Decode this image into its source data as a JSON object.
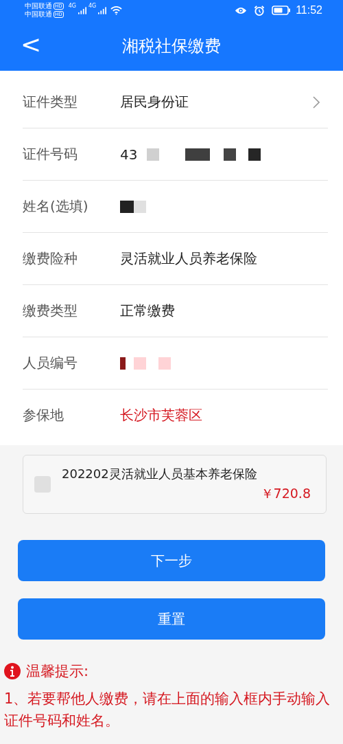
{
  "status_bar": {
    "carriers": [
      {
        "name": "中国联通",
        "badge": "HD"
      },
      {
        "name": "中国联通",
        "badge": "HD"
      }
    ],
    "signals": [
      {
        "network": "4G"
      },
      {
        "network": "4G"
      }
    ],
    "time": "11:52"
  },
  "header": {
    "title": "湘税社保缴费",
    "back": "<"
  },
  "form": [
    {
      "label": "证件类型",
      "kind": "select",
      "value": "居民身份证"
    },
    {
      "label": "证件号码",
      "kind": "masked",
      "value": "43"
    },
    {
      "label": "姓名(选填)",
      "kind": "masked"
    },
    {
      "label": "缴费险种",
      "kind": "plain",
      "value": "灵活就业人员养老保险"
    },
    {
      "label": "缴费类型",
      "kind": "plain",
      "value": "正常缴费"
    },
    {
      "label": "人员编号",
      "kind": "masked"
    },
    {
      "label": "参保地",
      "kind": "highlight",
      "value": "长沙市芙蓉区"
    }
  ],
  "items": [
    {
      "title": "202202灵活就业人员基本养老保险",
      "amount": "￥720.8",
      "checked": false
    }
  ],
  "buttons": [
    {
      "label": "下一步"
    },
    {
      "label": "重置"
    }
  ],
  "tips": {
    "title": "温馨提示:",
    "lines": [
      "1、若要帮他人缴费，请在上面的输入框内手动输入证件号码和姓名。"
    ]
  }
}
